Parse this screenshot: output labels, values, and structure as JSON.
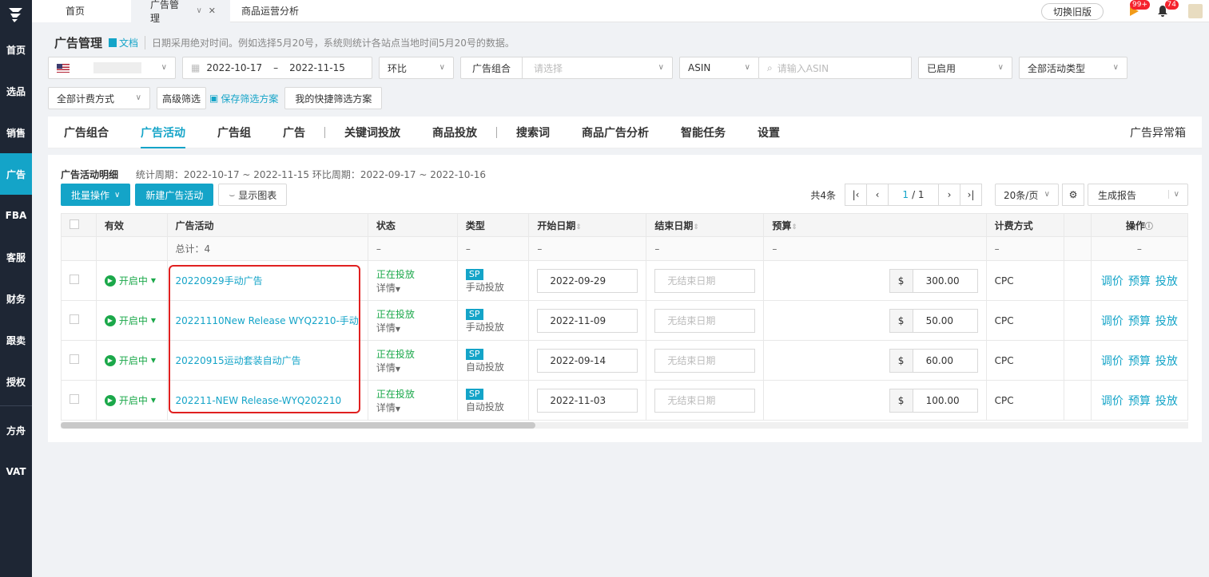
{
  "sidebar": {
    "items": [
      {
        "label": "首页"
      },
      {
        "label": "选品"
      },
      {
        "label": "销售"
      },
      {
        "label": "广告"
      },
      {
        "label": "FBA"
      },
      {
        "label": "客服"
      },
      {
        "label": "财务"
      },
      {
        "label": "跟卖"
      },
      {
        "label": "授权"
      },
      {
        "label": "方舟"
      },
      {
        "label": "VAT"
      }
    ]
  },
  "topbar": {
    "tabs": [
      {
        "label": "首页"
      },
      {
        "label": "广告管理"
      },
      {
        "label": "商品运营分析"
      }
    ],
    "switch_old": "切换旧版",
    "notify_count": "99+",
    "bell_count": "74"
  },
  "header": {
    "title": "广告管理",
    "doc": "文档",
    "hint": "日期采用绝对时间。例如选择5月20号，系统则统计各站点当地时间5月20号的数据。"
  },
  "filters": {
    "date_start": "2022-10-17",
    "date_sep": "–",
    "date_end": "2022-11-15",
    "compare": "环比",
    "portfolio": "广告组合",
    "portfolio_placeholder": "请选择",
    "asin": "ASIN",
    "asin_placeholder": "请输入ASIN",
    "status": "已启用",
    "campaign_type": "全部活动类型",
    "billing": "全部计费方式",
    "advanced": "高级筛选",
    "save_plan": "保存筛选方案",
    "my_plans": "我的快捷筛选方案"
  },
  "subtabs": {
    "items": [
      {
        "label": "广告组合"
      },
      {
        "label": "广告活动"
      },
      {
        "label": "广告组"
      },
      {
        "label": "广告"
      },
      {
        "label": "关键词投放"
      },
      {
        "label": "商品投放"
      },
      {
        "label": "搜索词"
      },
      {
        "label": "商品广告分析"
      },
      {
        "label": "智能任务"
      },
      {
        "label": "设置"
      }
    ],
    "right": "广告异常箱"
  },
  "panel": {
    "title": "广告活动明细",
    "period": "统计周期：2022-10-17 ~ 2022-11-15 环比周期：2022-09-17 ~ 2022-10-16",
    "batch": "批量操作",
    "new_campaign": "新建广告活动",
    "show_chart": "显示图表",
    "total": "共4条",
    "page_current": "1",
    "page_total": "/ 1",
    "page_size": "20条/页",
    "report": "生成报告"
  },
  "table": {
    "headers": [
      "有效",
      "广告活动",
      "状态",
      "类型",
      "开始日期",
      "结束日期",
      "预算",
      "计费方式",
      "操作"
    ],
    "summary": {
      "label": "总计：4",
      "dash": "–"
    },
    "on_label": "开启中",
    "status_label": "正在投放",
    "detail_label": "详情",
    "end_placeholder": "无结束日期",
    "currency": "$",
    "ops": [
      "调价",
      "预算",
      "投放"
    ],
    "rows": [
      {
        "name": "20220929手动广告",
        "type": "SP",
        "type_sub": "手动投放",
        "start": "2022-09-29",
        "budget": "300.00",
        "billing": "CPC"
      },
      {
        "name": "20221110New Release WYQ2210-手动",
        "type": "SP",
        "type_sub": "手动投放",
        "start": "2022-11-09",
        "budget": "50.00",
        "billing": "CPC"
      },
      {
        "name": "20220915运动套装自动广告",
        "type": "SP",
        "type_sub": "自动投放",
        "start": "2022-09-14",
        "budget": "60.00",
        "billing": "CPC"
      },
      {
        "name": "202211-NEW Release-WYQ202210",
        "type": "SP",
        "type_sub": "自动投放",
        "start": "2022-11-03",
        "budget": "100.00",
        "billing": "CPC"
      }
    ]
  },
  "colors": {
    "accent": "#14a4c8",
    "success": "#1ba84a",
    "sidebar": "#1e2634",
    "highlight": "#e02020"
  }
}
